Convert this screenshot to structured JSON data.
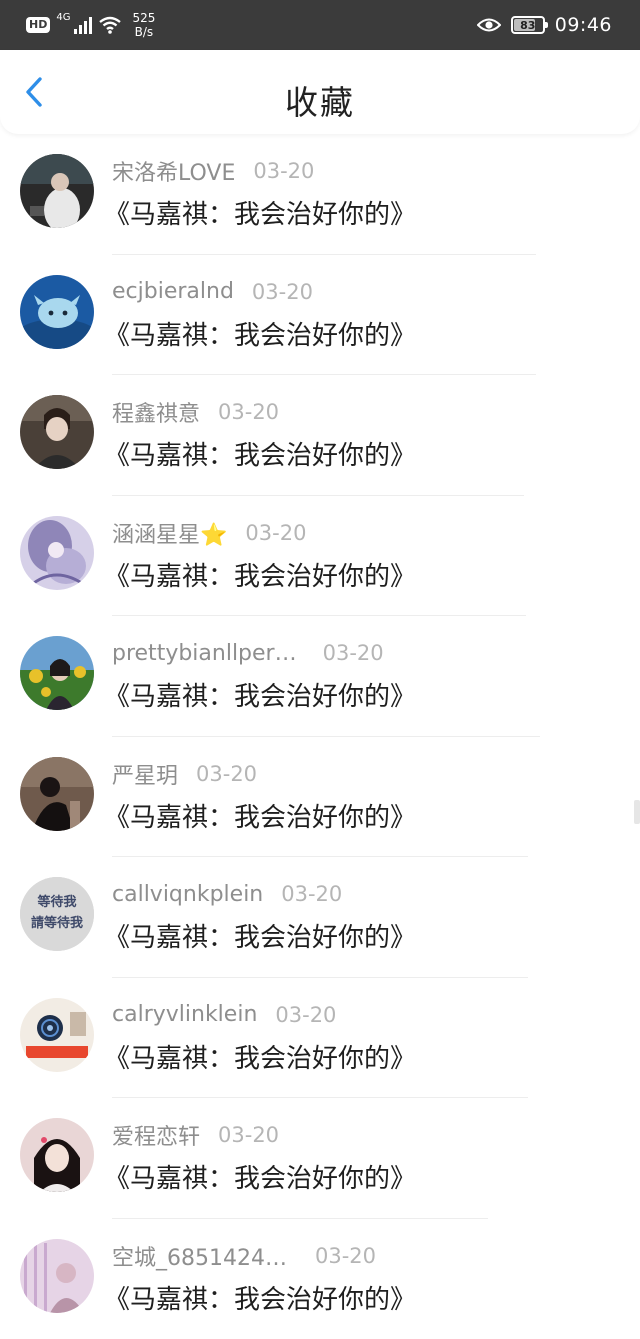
{
  "status_bar": {
    "hd": "HD",
    "network": "4G",
    "speed_value": "525",
    "speed_unit": "B/s",
    "battery": "83",
    "battery_level": 0.83,
    "time": "09:46"
  },
  "header": {
    "title": "收藏"
  },
  "colors": {
    "accent": "#2e8ee8",
    "status_bar": "#3b3b3b"
  },
  "favorites": [
    {
      "username": "宋洛希LOVE",
      "date": "03-20",
      "work": "《马嘉祺：我会治好你的》"
    },
    {
      "username": "ecjbieralnd",
      "date": "03-20",
      "work": "《马嘉祺：我会治好你的》"
    },
    {
      "username": "程鑫祺意",
      "date": "03-20",
      "work": "《马嘉祺：我会治好你的》"
    },
    {
      "username": "涵涵星星⭐",
      "date": "03-20",
      "work": "《马嘉祺：我会治好你的》"
    },
    {
      "username": "prettybianllper…",
      "date": "03-20",
      "work": "《马嘉祺：我会治好你的》"
    },
    {
      "username": "严星玥",
      "date": "03-20",
      "work": "《马嘉祺：我会治好你的》"
    },
    {
      "username": "callviqnkplein",
      "date": "03-20",
      "work": "《马嘉祺：我会治好你的》"
    },
    {
      "username": "calryvlinklein",
      "date": "03-20",
      "work": "《马嘉祺：我会治好你的》"
    },
    {
      "username": "爱程恋轩",
      "date": "03-20",
      "work": "《马嘉祺：我会治好你的》"
    },
    {
      "username": "空城_6851424…",
      "date": "03-20",
      "work": "《马嘉祺：我会治好你的》"
    }
  ],
  "avatar_7_text": [
    "等待我",
    "請等待我"
  ]
}
